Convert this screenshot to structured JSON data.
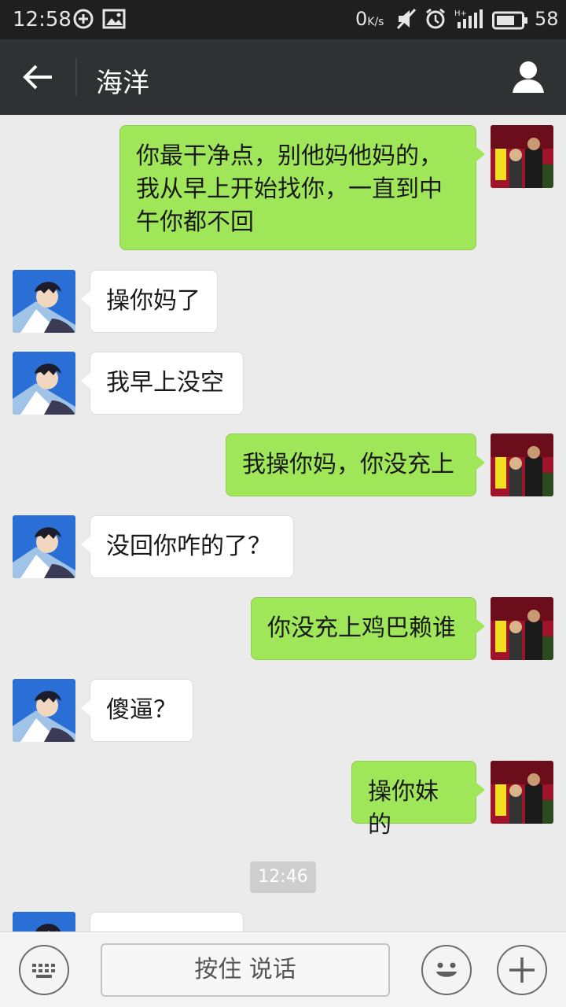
{
  "status_bar": {
    "time": "12:58",
    "network_speed_value": "0",
    "network_speed_unit": "K/s",
    "battery": "58",
    "icons": [
      "sync-icon",
      "image-icon",
      "mute-icon",
      "alarm-icon",
      "signal-icon",
      "battery-icon"
    ]
  },
  "header": {
    "title": "海洋",
    "back_icon": "back-arrow-icon",
    "profile_icon": "contact-profile-icon"
  },
  "messages": [
    {
      "side": "out",
      "lines": [
        "你最干净点，别他妈他妈的，",
        "我从早上开始找你，一直到中",
        "午你都不回"
      ]
    },
    {
      "side": "in",
      "lines": [
        "操你妈了"
      ]
    },
    {
      "side": "in",
      "lines": [
        "我早上没空"
      ]
    },
    {
      "side": "out",
      "lines": [
        "我操你妈，你没充上"
      ]
    },
    {
      "side": "in",
      "lines": [
        "没回你咋的了？"
      ]
    },
    {
      "side": "out",
      "lines": [
        "你没充上鸡巴赖谁"
      ]
    },
    {
      "side": "in",
      "lines": [
        "傻逼？"
      ]
    },
    {
      "side": "out",
      "lines": [
        "操你妹的"
      ]
    }
  ],
  "timestamp": "12:46",
  "input_bar": {
    "keyboard_icon": "keyboard-icon",
    "hold_to_talk_label": "按住 说话",
    "emoji_icon": "emoji-icon",
    "more_icon": "plus-icon"
  },
  "colors": {
    "outgoing_bubble": "#9fe658",
    "incoming_bubble": "#ffffff",
    "title_bar": "#2f3133",
    "status_bar": "#1f1f1f",
    "chat_background": "#ebebeb"
  }
}
